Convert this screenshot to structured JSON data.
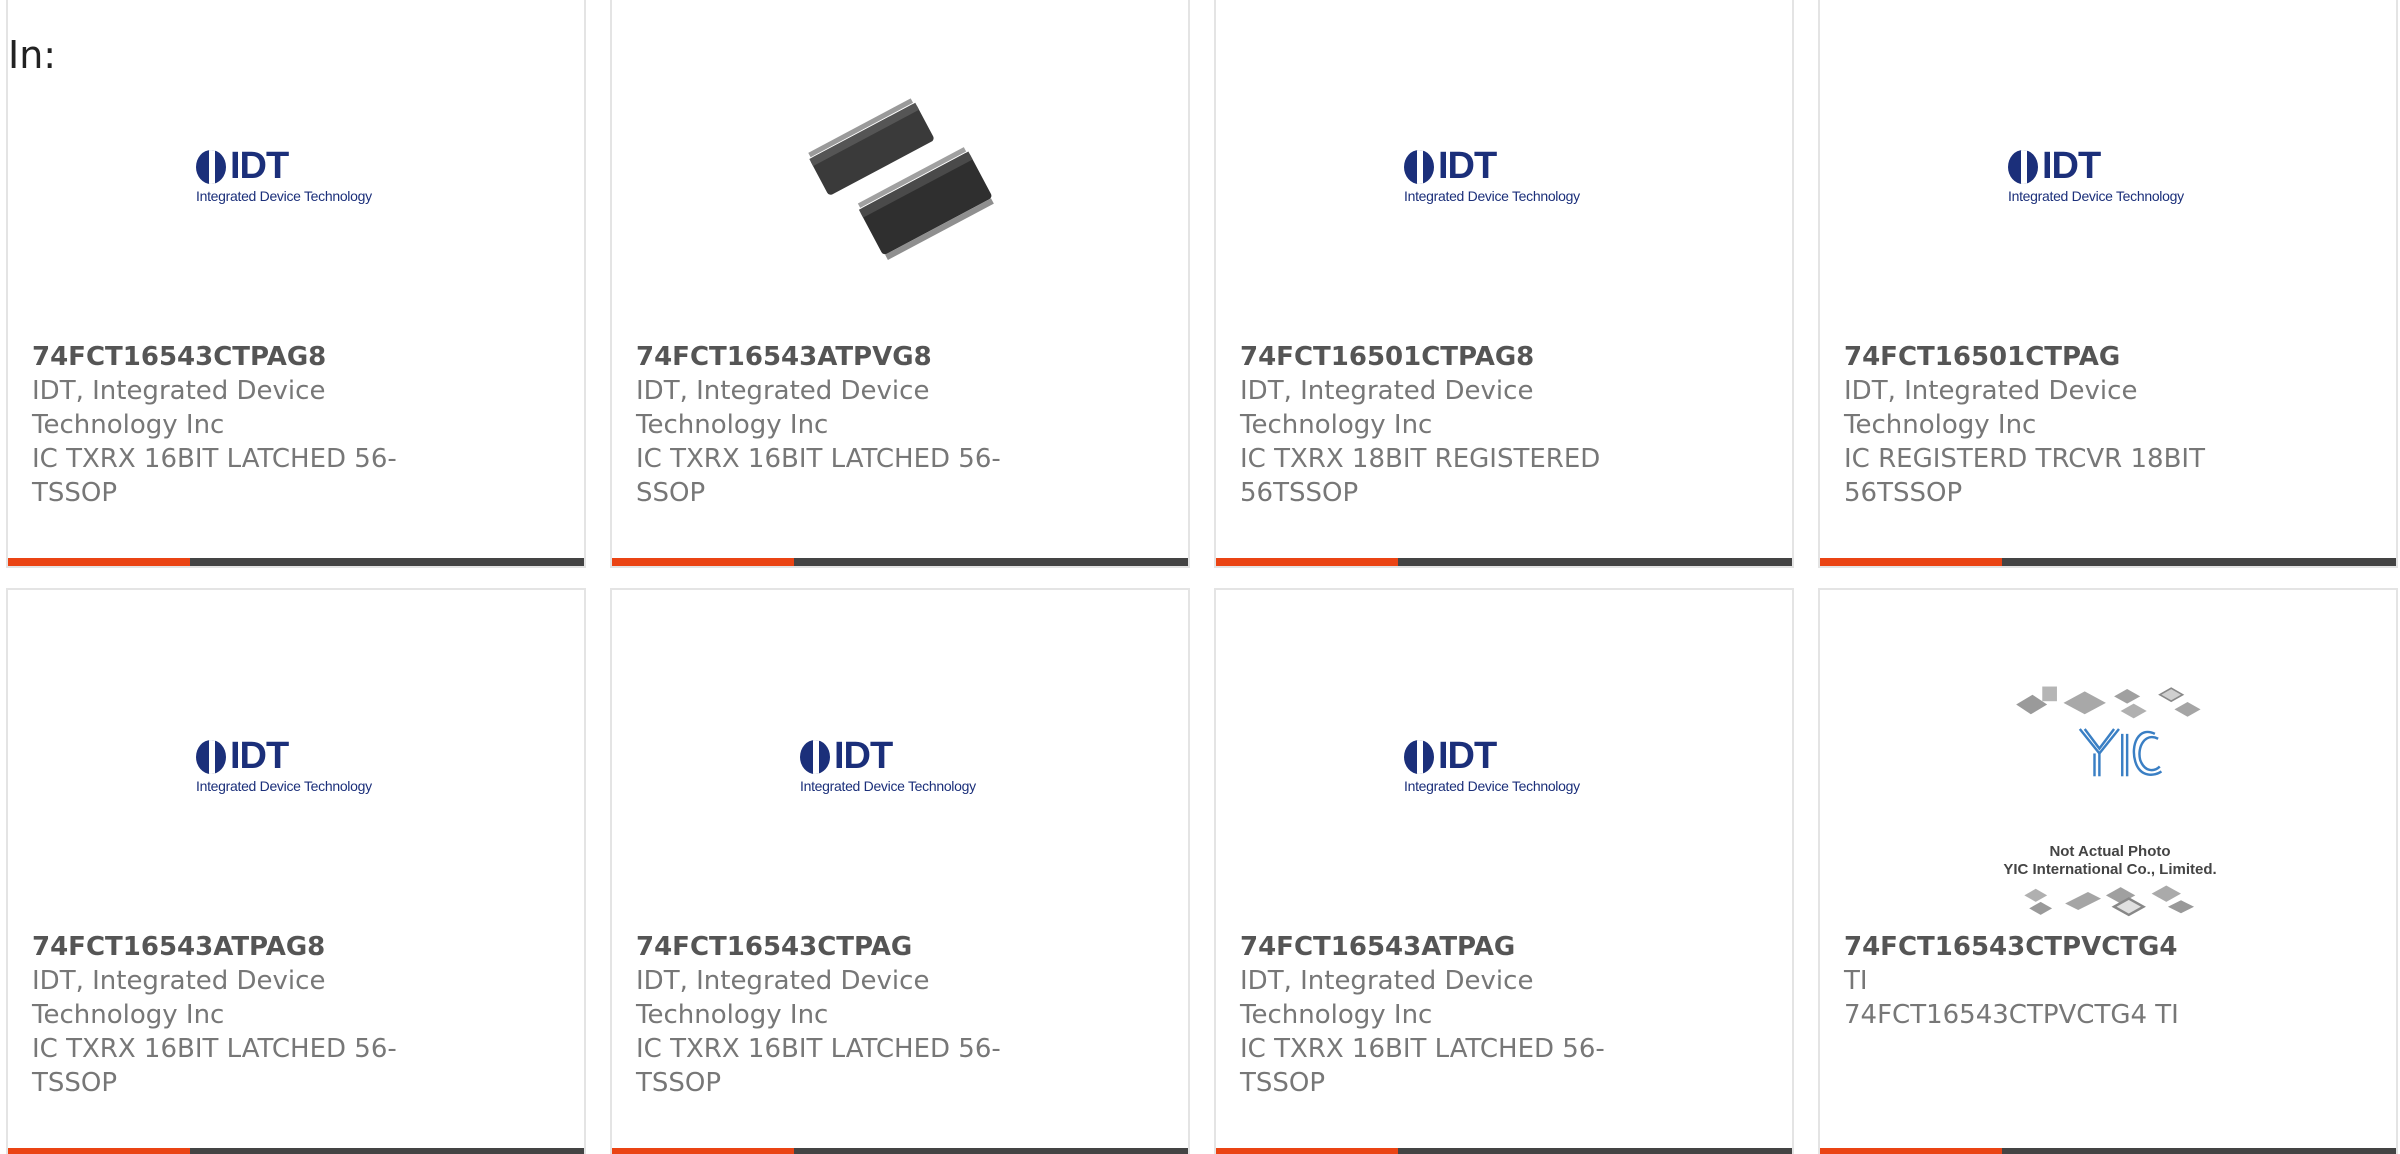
{
  "header": {
    "label": "In:"
  },
  "brand": {
    "accent": "#ea4414",
    "bar": "#444444",
    "idt_blue": "#1b2f7a"
  },
  "logos": {
    "idt_letters": "IDT",
    "idt_tagline": "Integrated Device Technology",
    "yic_caption_line1": "Not Actual Photo",
    "yic_caption_line2": "YIC International Co., Limited."
  },
  "products": [
    {
      "part": "74FCT16543CTPAG8",
      "mfr": "IDT, Integrated Device Technology Inc",
      "desc": "IC TXRX 16BIT LATCHED 56-TSSOP",
      "image": "idt-logo"
    },
    {
      "part": "74FCT16543ATPVG8",
      "mfr": "IDT, Integrated Device Technology Inc",
      "desc": "IC TXRX 16BIT LATCHED 56-SSOP",
      "image": "chip-photo"
    },
    {
      "part": "74FCT16501CTPAG8",
      "mfr": "IDT, Integrated Device Technology Inc",
      "desc": "IC TXRX 18BIT REGISTERED 56TSSOP",
      "image": "idt-logo"
    },
    {
      "part": "74FCT16501CTPAG",
      "mfr": "IDT, Integrated Device Technology Inc",
      "desc": "IC REGISTERD TRCVR 18BIT 56TSSOP",
      "image": "idt-logo"
    },
    {
      "part": "74FCT16543ATPAG8",
      "mfr": "IDT, Integrated Device Technology Inc",
      "desc": "IC TXRX 16BIT LATCHED 56-TSSOP",
      "image": "idt-logo"
    },
    {
      "part": "74FCT16543CTPAG",
      "mfr": "IDT, Integrated Device Technology Inc",
      "desc": "IC TXRX 16BIT LATCHED 56-TSSOP",
      "image": "idt-logo"
    },
    {
      "part": "74FCT16543ATPAG",
      "mfr": "IDT, Integrated Device Technology Inc",
      "desc": "IC TXRX 16BIT LATCHED 56-TSSOP",
      "image": "idt-logo"
    },
    {
      "part": "74FCT16543CTPVCTG4",
      "mfr": "TI",
      "desc": "74FCT16543CTPVCTG4 TI",
      "image": "yic-placeholder"
    }
  ]
}
